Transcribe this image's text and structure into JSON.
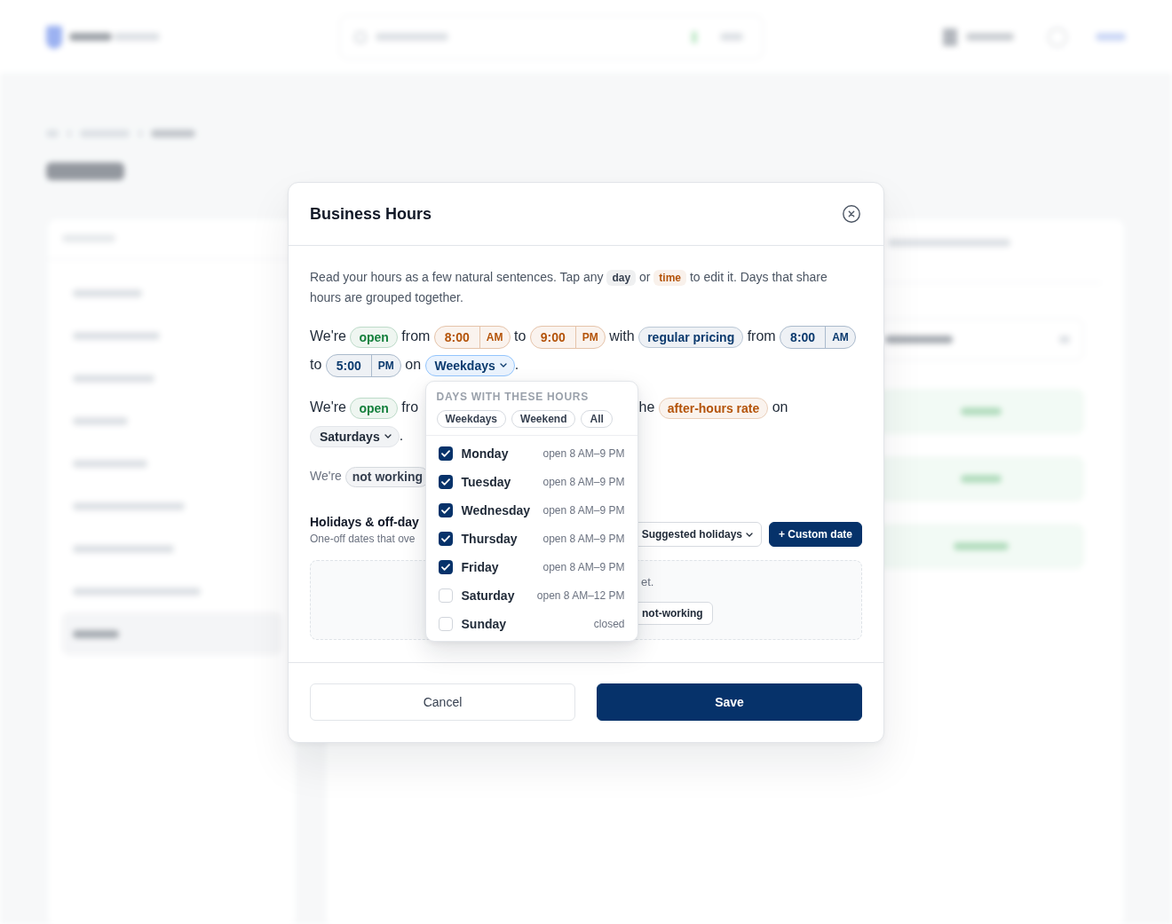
{
  "dialog": {
    "title": "Business Hours",
    "intro": [
      {
        "kind": "word",
        "text": "Read your hours as a few natural sentences. Tap any"
      },
      {
        "kind": "hint",
        "text": "day",
        "color": "#374151"
      },
      {
        "kind": "word",
        "text": "or"
      },
      {
        "kind": "hint",
        "text": "time",
        "color": "#b45309"
      },
      {
        "kind": "word",
        "text": "to edit it. Days that share hours are grouped together."
      }
    ],
    "sentences": [
      {
        "kind": "rule",
        "parts": [
          {
            "kind": "word",
            "text": "We're"
          },
          {
            "kind": "tag",
            "text": "open",
            "color": "#15803d"
          },
          {
            "kind": "word",
            "text": "from"
          },
          {
            "kind": "time",
            "time": "8:00",
            "period": "AM",
            "color": "#b45309"
          },
          {
            "kind": "word",
            "text": "to"
          },
          {
            "kind": "time",
            "time": "9:00",
            "period": "PM",
            "color": "#b45309"
          },
          {
            "kind": "word",
            "text": "with"
          },
          {
            "kind": "tag",
            "text": "regular pricing",
            "color": "#0b3a6e"
          },
          {
            "kind": "word",
            "text": "from"
          },
          {
            "kind": "time",
            "time": "8:00",
            "period": "AM",
            "color": "#0b3a6e"
          },
          {
            "kind": "word",
            "text": "to"
          },
          {
            "kind": "time",
            "time": "5:00",
            "period": "PM",
            "color": "#0b3a6e"
          },
          {
            "kind": "word",
            "text": "on"
          },
          {
            "kind": "days",
            "text": "Weekdays",
            "expanded": true
          },
          {
            "kind": "punct",
            "text": "."
          }
        ]
      },
      {
        "kind": "rule",
        "parts": [
          {
            "kind": "word",
            "text": "We're"
          },
          {
            "kind": "tag",
            "text": "open",
            "color": "#15803d"
          },
          {
            "kind": "word",
            "text": "fro"
          },
          {
            "kind": "covered"
          },
          {
            "kind": "word",
            "text": "he"
          },
          {
            "kind": "tag",
            "text": "after-hours rate",
            "color": "#b45309"
          },
          {
            "kind": "word",
            "text": "on"
          },
          {
            "kind": "days",
            "text": "Saturdays",
            "expanded": false
          },
          {
            "kind": "punct",
            "text": "."
          }
        ]
      },
      {
        "kind": "note",
        "parts": [
          {
            "kind": "word",
            "text": "We're"
          },
          {
            "kind": "tag",
            "text": "not working",
            "color": "#374151"
          }
        ]
      }
    ],
    "popover": {
      "title": "DAYS WITH THESE HOURS",
      "presets": [
        "Weekdays",
        "Weekend",
        "All"
      ],
      "days": [
        {
          "name": "Monday",
          "hours": "open 8 AM–9 PM",
          "checked": true
        },
        {
          "name": "Tuesday",
          "hours": "open 8 AM–9 PM",
          "checked": true
        },
        {
          "name": "Wednesday",
          "hours": "open 8 AM–9 PM",
          "checked": true
        },
        {
          "name": "Thursday",
          "hours": "open 8 AM–9 PM",
          "checked": true
        },
        {
          "name": "Friday",
          "hours": "open 8 AM–9 PM",
          "checked": true
        },
        {
          "name": "Saturday",
          "hours": "open 8 AM–12 PM",
          "checked": false
        },
        {
          "name": "Sunday",
          "hours": "closed",
          "checked": false
        }
      ]
    },
    "holidays": {
      "title": "Holidays & off-day",
      "subtitle": "One-off dates that ove",
      "actions": [
        {
          "kind": "menu",
          "label": "Suggested holidays"
        },
        {
          "kind": "add",
          "label": "+ Custom date"
        }
      ],
      "empty": {
        "text": "et.",
        "action": "not-working"
      }
    },
    "actions": [
      {
        "kind": "cancel",
        "label": "Cancel"
      },
      {
        "kind": "save",
        "label": "Save"
      }
    ]
  }
}
